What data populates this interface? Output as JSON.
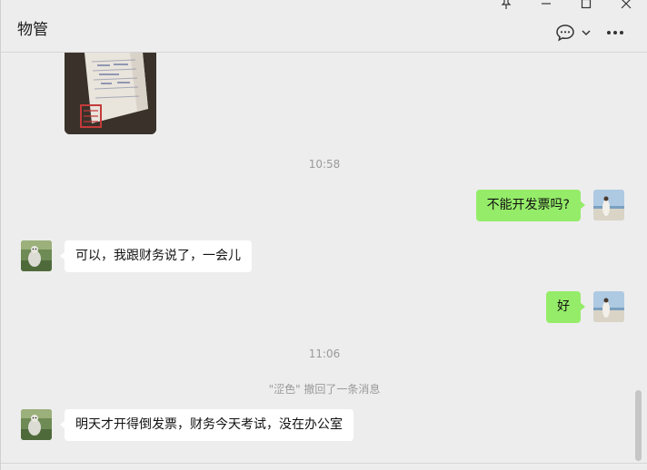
{
  "window": {
    "controls": [
      {
        "name": "pin-icon",
        "glyph": "pin"
      },
      {
        "name": "minimize-icon",
        "glyph": "minimize"
      },
      {
        "name": "maximize-icon",
        "glyph": "maximize"
      },
      {
        "name": "close-icon",
        "glyph": "close"
      }
    ]
  },
  "header": {
    "title": "物管"
  },
  "messages": {
    "time_1": "10:58",
    "time_2": "11:06",
    "msg_out_1": "不能开发票吗?",
    "msg_in_1": "可以，我跟财务说了，一会儿",
    "msg_out_2": "好",
    "recall_notice": "\"涩色\" 撤回了一条消息",
    "msg_in_2": "明天才开得倒发票，财务今天考试，没在办公室"
  },
  "colors": {
    "background": "#ededed",
    "outgoing_bubble": "#95ec69",
    "incoming_bubble": "#ffffff",
    "timestamp": "#9a9a9a"
  }
}
